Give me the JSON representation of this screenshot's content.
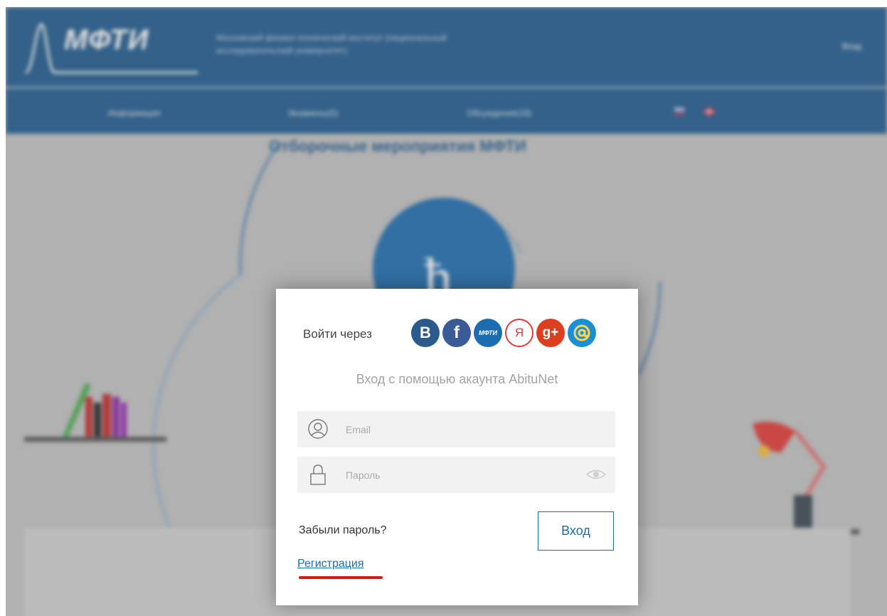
{
  "background": {
    "logo_text": "МФТИ",
    "university_name": "Московский физико-технический институт (национальный исследовательский университет)",
    "header_login": "Вход",
    "nav": [
      "Информация",
      "Экзамены(0)",
      "Обсуждения(19)"
    ],
    "page_title": "Отборочные мероприятия МФТИ",
    "colors": {
      "header_blue": "#1d5a8f",
      "background": "#c4c4c4"
    }
  },
  "modal": {
    "social_label": "Войти через",
    "social": [
      {
        "name": "vk-icon",
        "glyph": "B"
      },
      {
        "name": "facebook-icon",
        "glyph": "f"
      },
      {
        "name": "mipt-icon",
        "glyph": "МФТИ"
      },
      {
        "name": "yandex-icon",
        "glyph": "Я"
      },
      {
        "name": "google-plus-icon",
        "glyph": "g+"
      },
      {
        "name": "mailru-icon",
        "glyph": "@"
      }
    ],
    "subtitle": "Вход с помощью акаунта AbituNet",
    "email_placeholder": "Email",
    "password_placeholder": "Пароль",
    "forgot": "Забыли пароль?",
    "submit": "Вход",
    "register": "Регистрация",
    "colors": {
      "link": "#1b6db2",
      "underline": "#d21a1a"
    }
  }
}
